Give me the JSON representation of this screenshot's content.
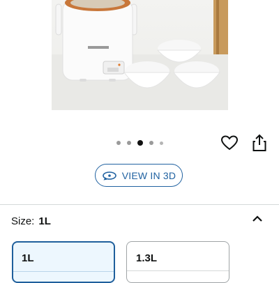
{
  "gallery": {
    "image_count": 5,
    "active_index": 2
  },
  "actions": {
    "view_3d_label": "VIEW IN 3D",
    "favorite_icon": "heart-outline-icon",
    "share_icon": "share-icon"
  },
  "size": {
    "label": "Size:",
    "selected": "1L",
    "options": [
      {
        "label": "1L",
        "selected": true
      },
      {
        "label": "1.3L",
        "selected": false
      }
    ]
  },
  "colors": {
    "accent": "#2162a1",
    "selected_border": "#1f5f9c",
    "selected_bg": "#edf7fe",
    "rice_cooker_lid": "#c8773a"
  }
}
